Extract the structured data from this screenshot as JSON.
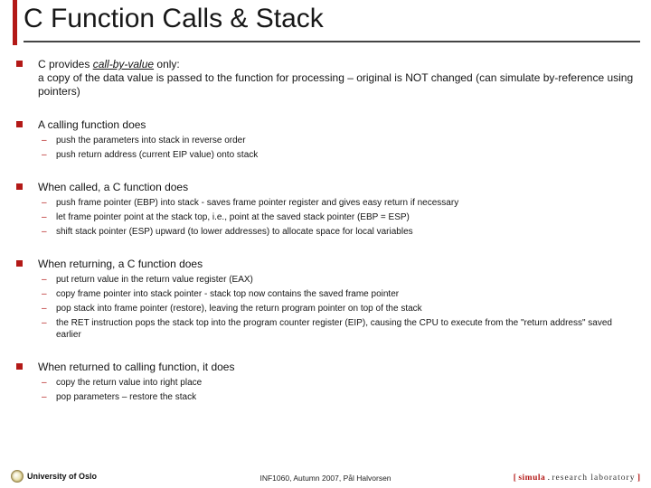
{
  "title": "C Function Calls & Stack",
  "bullets": [
    {
      "lead": "C provides ",
      "ulit": "call-by-value",
      "tail": " only:\na copy of the data value is passed to the function for processing – original is NOT changed (can simulate by-reference using pointers)",
      "sub": []
    },
    {
      "text": "A calling function does",
      "sub": [
        "push the parameters into stack in reverse order",
        "push return address (current EIP value) onto stack"
      ]
    },
    {
      "text": "When called, a C function does",
      "sub": [
        "push frame pointer (EBP) into stack - saves frame pointer register and gives easy return if necessary",
        "let frame pointer point at the stack top, i.e., point at the saved stack pointer (EBP = ESP)",
        "shift stack pointer (ESP) upward (to lower addresses) to allocate space for local variables"
      ]
    },
    {
      "text": "When returning, a C function does",
      "sub": [
        "put return value in the return value register (EAX)",
        "copy frame pointer into stack pointer - stack top now contains the saved frame pointer",
        "pop stack into frame pointer (restore), leaving the return program pointer on top of the stack",
        "the RET instruction pops the stack top into the program counter register (EIP), causing the CPU to execute from the \"return address\" saved earlier"
      ]
    },
    {
      "text": "When returned to calling function, it does",
      "sub": [
        "copy the return value into right place",
        "pop parameters – restore the stack"
      ]
    }
  ],
  "footer": {
    "left": "University of Oslo",
    "center": "INF1060, Autumn 2007, Pål Halvorsen",
    "right_bracket_open": "[ ",
    "right_sim": "simula",
    "right_dot": " . ",
    "right_rl": "research laboratory",
    "right_bracket_close": " ]"
  }
}
